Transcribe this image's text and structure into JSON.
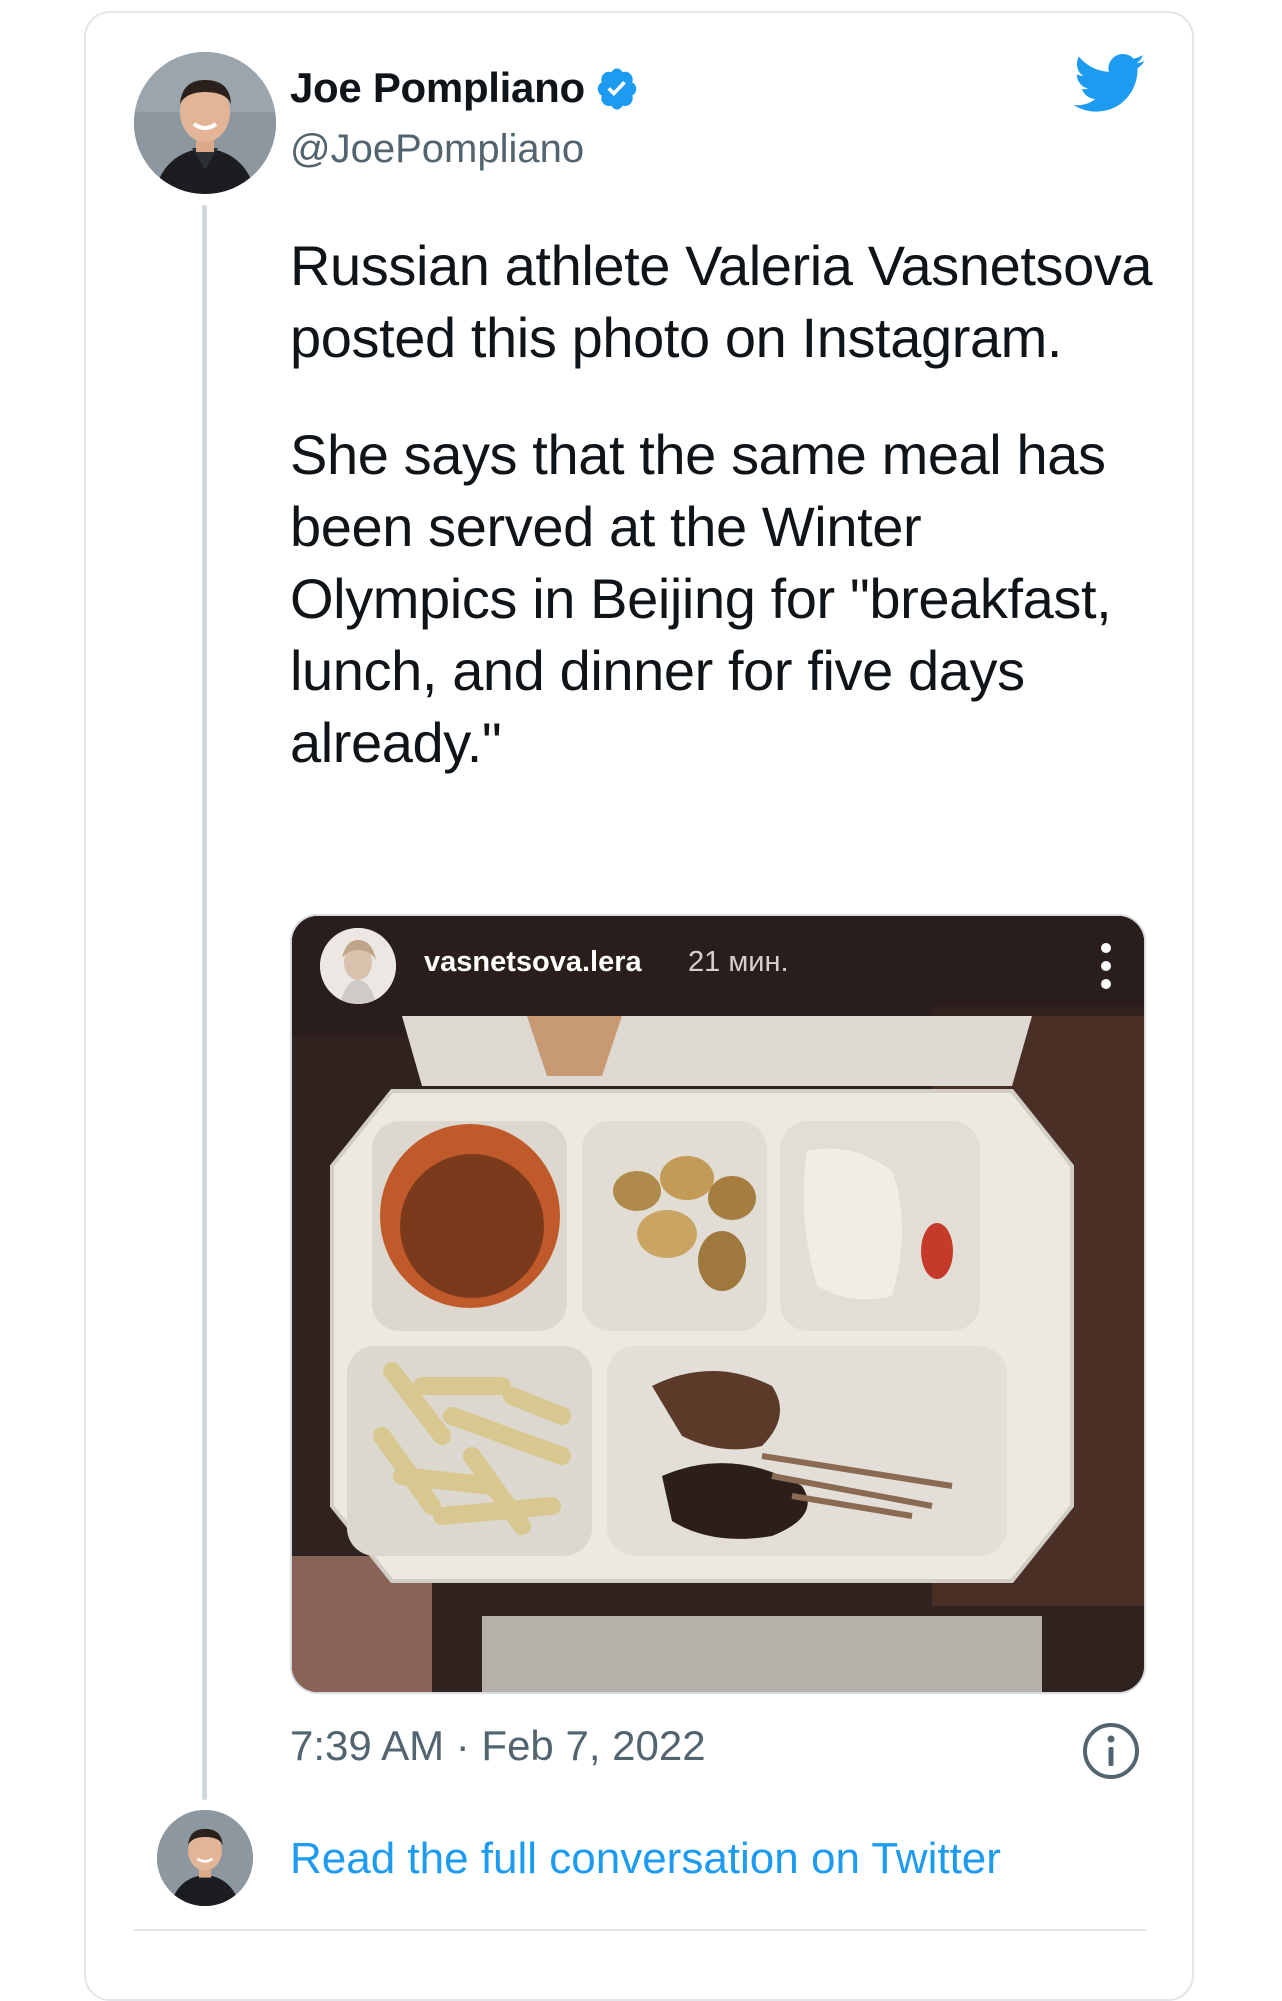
{
  "tweet": {
    "author_name": "Joe Pompliano",
    "author_handle": "@JoePompliano",
    "verified": true,
    "text_paragraphs": [
      "Russian athlete Valeria Vasnetsova posted this photo on Instagram.",
      "She says that the same meal has been served at the Winter Olympics in Beijing for \"breakfast, lunch, and dinner for five days already.\""
    ],
    "timestamp": "7:39 AM · Feb 7, 2022",
    "read_more_label": "Read the full conversation on Twitter"
  },
  "media": {
    "ig_username": "vasnetsova.lera",
    "ig_time": "21 мин."
  },
  "icons": {
    "brand": "twitter-bird-icon",
    "verified": "verified-badge-icon",
    "info": "info-icon",
    "more": "more-vertical-icon"
  },
  "colors": {
    "twitter_blue": "#1d9bf0",
    "text_primary": "#0f1419",
    "text_secondary": "#536471",
    "border": "#e1e6ea"
  }
}
